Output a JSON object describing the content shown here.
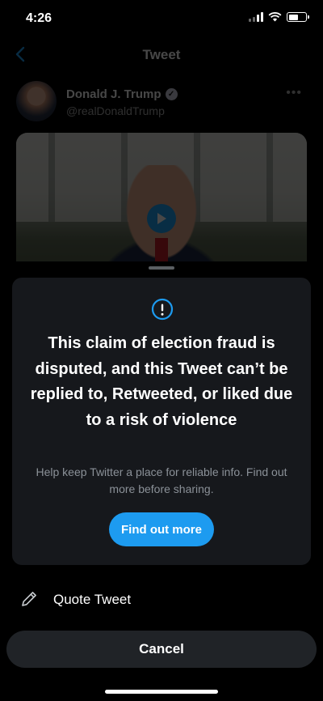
{
  "status_bar": {
    "time": "4:26"
  },
  "nav": {
    "title": "Tweet"
  },
  "author": {
    "name": "Donald J. Trump",
    "handle": "@realDonaldTrump"
  },
  "icons": {
    "back": "chevron-left-icon",
    "verified": "verified-badge-icon",
    "more": "more-icon",
    "play": "play-icon",
    "info": "exclamation-circle-icon",
    "quote": "pencil-icon"
  },
  "notice": {
    "headline": "This claim of election fraud is disputed, and this Tweet can’t be replied to, Retweeted, or liked due to a risk of violence",
    "subtext": "Help keep Twitter a place for reliable info. Find out more before sharing.",
    "button_label": "Find out more"
  },
  "actions": {
    "quote_label": "Quote Tweet",
    "cancel_label": "Cancel"
  },
  "colors": {
    "accent": "#1d9bf0",
    "card_bg": "#16181c",
    "button_bg": "#202327",
    "secondary_text": "#8b9198"
  }
}
